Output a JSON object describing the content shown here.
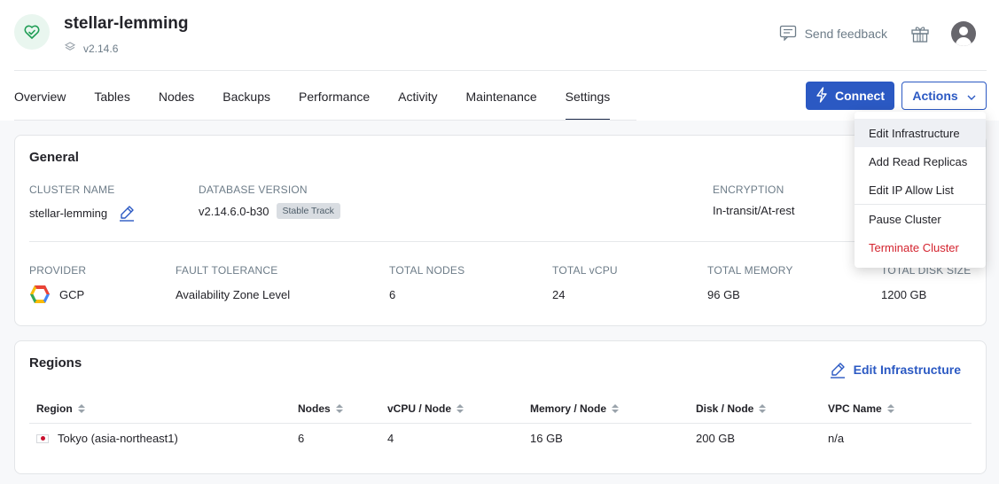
{
  "header": {
    "cluster_name": "stellar-lemming",
    "version": "v2.14.6",
    "feedback_label": "Send feedback"
  },
  "tabs": [
    "Overview",
    "Tables",
    "Nodes",
    "Backups",
    "Performance",
    "Activity",
    "Maintenance",
    "Settings"
  ],
  "active_tab": "Settings",
  "buttons": {
    "connect": "Connect",
    "actions": "Actions"
  },
  "general": {
    "title": "General",
    "cluster_name_label": "CLUSTER NAME",
    "cluster_name_value": "stellar-lemming",
    "db_version_label": "DATABASE VERSION",
    "db_version_value": "v2.14.6.0-b30",
    "db_track_badge": "Stable Track",
    "encryption_label": "ENCRYPTION",
    "encryption_value": "In-transit/At-rest",
    "provider_label": "PROVIDER",
    "provider_value": "GCP",
    "fault_tolerance_label": "FAULT TOLERANCE",
    "fault_tolerance_value": "Availability Zone Level",
    "total_nodes_label": "TOTAL NODES",
    "total_nodes_value": "6",
    "total_vcpu_label": "TOTAL vCPU",
    "total_vcpu_value": "24",
    "total_memory_label": "TOTAL MEMORY",
    "total_memory_value": "96 GB",
    "total_disk_label": "TOTAL DISK SIZE",
    "total_disk_value": "1200 GB"
  },
  "regions": {
    "title": "Regions",
    "edit_label": "Edit Infrastructure",
    "columns": [
      "Region",
      "Nodes",
      "vCPU / Node",
      "Memory / Node",
      "Disk / Node",
      "VPC Name"
    ],
    "rows": [
      [
        "Tokyo (asia-northeast1)",
        "6",
        "4",
        "16 GB",
        "200 GB",
        "n/a"
      ]
    ]
  },
  "actions_menu": {
    "items": [
      "Edit Infrastructure",
      "Add Read Replicas",
      "Edit IP Allow List",
      "Pause Cluster",
      "Terminate Cluster"
    ]
  },
  "colors": {
    "primary": "#2b59c3",
    "danger": "#d4232e",
    "health_green": "#1f9d55"
  }
}
